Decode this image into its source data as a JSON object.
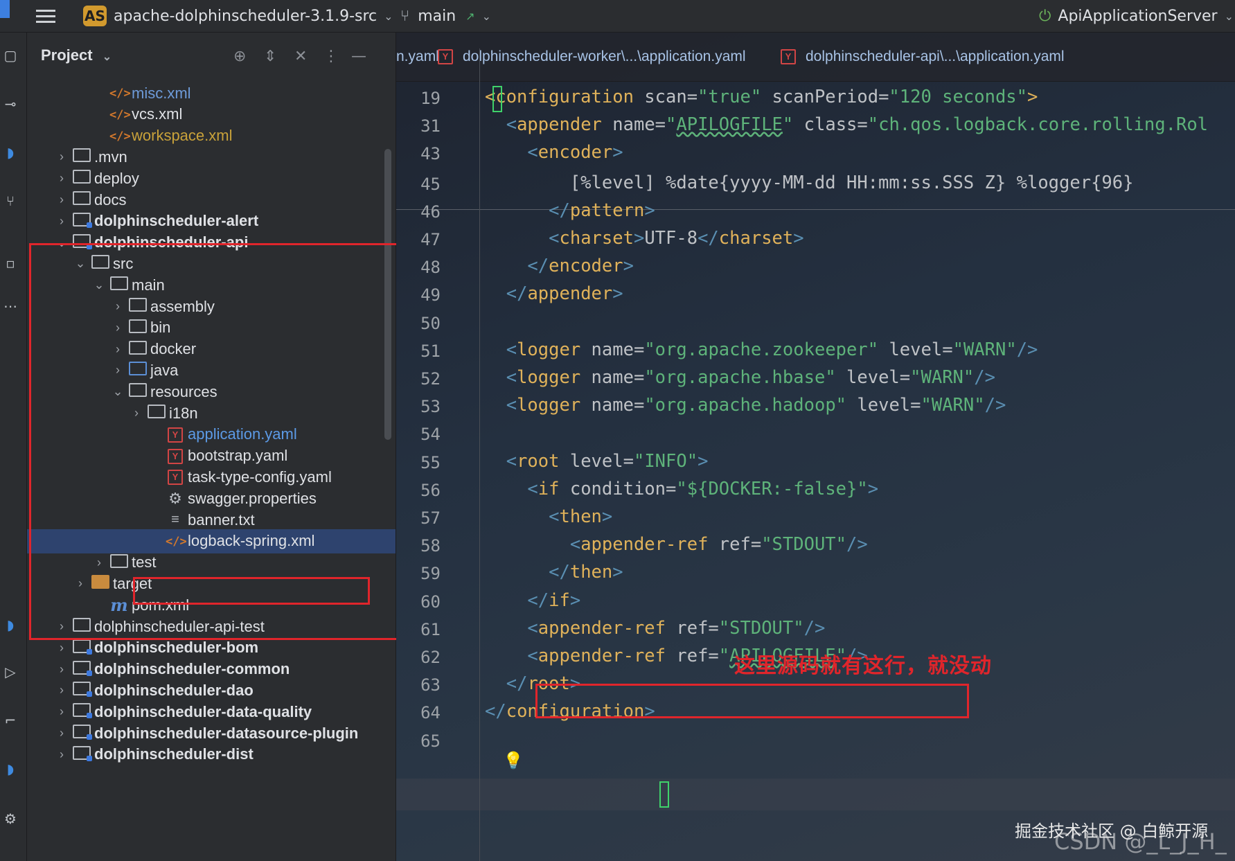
{
  "titlebar": {
    "project_badge": "AS",
    "project_name": "apache-dolphinscheduler-3.1.9-src",
    "branch": "main",
    "run_config": "ApiApplicationServer"
  },
  "panel": {
    "title": "Project"
  },
  "tree": [
    {
      "label": "misc.xml",
      "icon": "xml-file-icon",
      "style": "lbl-blue2"
    },
    {
      "label": "vcs.xml",
      "icon": "xml-file-icon",
      "style": "lbl-normal"
    },
    {
      "label": "workspace.xml",
      "icon": "xml-file-icon",
      "style": "lbl-orange"
    },
    {
      "label": ".mvn",
      "icon": "folder-icon",
      "style": "lbl-normal",
      "arrow": "›"
    },
    {
      "label": "deploy",
      "icon": "folder-icon",
      "style": "lbl-normal",
      "arrow": "›"
    },
    {
      "label": "docs",
      "icon": "folder-icon",
      "style": "lbl-normal",
      "arrow": "›"
    },
    {
      "label": "dolphinscheduler-alert",
      "icon": "module-folder-icon",
      "style": "lbl-bold",
      "arrow": "›"
    },
    {
      "label": "dolphinscheduler-api",
      "icon": "module-folder-icon",
      "style": "lbl-bold",
      "arrow": "⌄"
    },
    {
      "label": "src",
      "icon": "folder-icon",
      "style": "lbl-normal",
      "arrow": "⌄"
    },
    {
      "label": "main",
      "icon": "folder-icon",
      "style": "lbl-normal",
      "arrow": "⌄"
    },
    {
      "label": "assembly",
      "icon": "folder-icon",
      "style": "lbl-normal",
      "arrow": "›"
    },
    {
      "label": "bin",
      "icon": "folder-icon",
      "style": "lbl-normal",
      "arrow": "›"
    },
    {
      "label": "docker",
      "icon": "folder-icon",
      "style": "lbl-normal",
      "arrow": "›"
    },
    {
      "label": "java",
      "icon": "source-folder-icon",
      "style": "lbl-normal",
      "arrow": "›"
    },
    {
      "label": "resources",
      "icon": "resources-folder-icon",
      "style": "lbl-normal",
      "arrow": "⌄"
    },
    {
      "label": "i18n",
      "icon": "folder-icon",
      "style": "lbl-normal",
      "arrow": "›"
    },
    {
      "label": "application.yaml",
      "icon": "yaml-file-icon",
      "style": "lbl-blue"
    },
    {
      "label": "bootstrap.yaml",
      "icon": "yaml-file-icon",
      "style": "lbl-normal"
    },
    {
      "label": "task-type-config.yaml",
      "icon": "yaml-file-icon",
      "style": "lbl-normal"
    },
    {
      "label": "swagger.properties",
      "icon": "gear-icon",
      "style": "lbl-normal"
    },
    {
      "label": "banner.txt",
      "icon": "text-file-icon",
      "style": "lbl-normal"
    },
    {
      "label": "logback-spring.xml",
      "icon": "xml-file-icon",
      "style": "lbl-normal",
      "selected": true
    },
    {
      "label": "test",
      "icon": "folder-icon",
      "style": "lbl-normal",
      "arrow": "›"
    },
    {
      "label": "target",
      "icon": "excluded-folder-icon",
      "style": "lbl-normal",
      "arrow": "›"
    },
    {
      "label": "pom.xml",
      "icon": "maven-icon",
      "style": "lbl-normal"
    },
    {
      "label": "dolphinscheduler-api-test",
      "icon": "folder-icon",
      "style": "lbl-normal",
      "arrow": "›"
    },
    {
      "label": "dolphinscheduler-bom",
      "icon": "module-folder-icon",
      "style": "lbl-bold",
      "arrow": "›"
    },
    {
      "label": "dolphinscheduler-common",
      "icon": "module-folder-icon",
      "style": "lbl-bold",
      "arrow": "›"
    },
    {
      "label": "dolphinscheduler-dao",
      "icon": "module-folder-icon",
      "style": "lbl-bold",
      "arrow": "›"
    },
    {
      "label": "dolphinscheduler-data-quality",
      "icon": "module-folder-icon",
      "style": "lbl-bold",
      "arrow": "›"
    },
    {
      "label": "dolphinscheduler-datasource-plugin",
      "icon": "module-folder-icon",
      "style": "lbl-bold",
      "arrow": "›"
    },
    {
      "label": "dolphinscheduler-dist",
      "icon": "module-folder-icon",
      "style": "lbl-bold",
      "arrow": "›"
    }
  ],
  "tabs": [
    {
      "label": "n.yaml"
    },
    {
      "label": "dolphinscheduler-worker\\...\\application.yaml"
    },
    {
      "label": "dolphinscheduler-api\\...\\application.yaml"
    }
  ],
  "code_lines": [
    {
      "no": "19",
      "segs": [
        [
          "t",
          "<configuration"
        ],
        [
          "an",
          " scan="
        ],
        [
          "av",
          "\"true\""
        ],
        [
          "an",
          " scanPeriod="
        ],
        [
          "av",
          "\"120 seconds\""
        ],
        [
          "t",
          ">"
        ]
      ]
    },
    {
      "no": "31",
      "segs": [
        [
          "an",
          "  "
        ],
        [
          "ab",
          "<"
        ],
        [
          "t",
          "appender"
        ],
        [
          "an",
          " name="
        ],
        [
          "av",
          "\""
        ],
        [
          "ul",
          "APILOGFILE"
        ],
        [
          "av",
          "\""
        ],
        [
          "an",
          " class="
        ],
        [
          "av",
          "\"ch.qos.logback.core.rolling.Rol"
        ]
      ]
    },
    {
      "no": "43",
      "segs": [
        [
          "an",
          "    "
        ],
        [
          "ab",
          "<"
        ],
        [
          "t",
          "encoder"
        ],
        [
          "ab",
          ">"
        ]
      ]
    },
    {
      "no": "45",
      "segs": [
        [
          "an",
          "        [%level] %date{yyyy-MM-dd HH:mm:ss.SSS Z} %logger{96}"
        ]
      ]
    },
    {
      "no": "46",
      "segs": [
        [
          "an",
          "      "
        ],
        [
          "ab",
          "</"
        ],
        [
          "t",
          "pattern"
        ],
        [
          "ab",
          ">"
        ]
      ]
    },
    {
      "no": "47",
      "segs": [
        [
          "an",
          "      "
        ],
        [
          "ab",
          "<"
        ],
        [
          "t",
          "charset"
        ],
        [
          "ab",
          ">"
        ],
        [
          "an",
          "UTF-8"
        ],
        [
          "ab",
          "</"
        ],
        [
          "t",
          "charset"
        ],
        [
          "ab",
          ">"
        ]
      ]
    },
    {
      "no": "48",
      "segs": [
        [
          "an",
          "    "
        ],
        [
          "ab",
          "</"
        ],
        [
          "t",
          "encoder"
        ],
        [
          "ab",
          ">"
        ]
      ]
    },
    {
      "no": "49",
      "segs": [
        [
          "an",
          "  "
        ],
        [
          "ab",
          "</"
        ],
        [
          "t",
          "appender"
        ],
        [
          "ab",
          ">"
        ]
      ]
    },
    {
      "no": "50",
      "segs": []
    },
    {
      "no": "51",
      "segs": [
        [
          "an",
          "  "
        ],
        [
          "ab",
          "<"
        ],
        [
          "t",
          "logger"
        ],
        [
          "an",
          " name="
        ],
        [
          "av",
          "\"org.apache.zookeeper\""
        ],
        [
          "an",
          " level="
        ],
        [
          "av",
          "\"WARN\""
        ],
        [
          "ab",
          "/>"
        ]
      ]
    },
    {
      "no": "52",
      "segs": [
        [
          "an",
          "  "
        ],
        [
          "ab",
          "<"
        ],
        [
          "t",
          "logger"
        ],
        [
          "an",
          " name="
        ],
        [
          "av",
          "\"org.apache.hbase\""
        ],
        [
          "an",
          " level="
        ],
        [
          "av",
          "\"WARN\""
        ],
        [
          "ab",
          "/>"
        ]
      ]
    },
    {
      "no": "53",
      "segs": [
        [
          "an",
          "  "
        ],
        [
          "ab",
          "<"
        ],
        [
          "t",
          "logger"
        ],
        [
          "an",
          " name="
        ],
        [
          "av",
          "\"org.apache.hadoop\""
        ],
        [
          "an",
          " level="
        ],
        [
          "av",
          "\"WARN\""
        ],
        [
          "ab",
          "/>"
        ]
      ]
    },
    {
      "no": "54",
      "segs": []
    },
    {
      "no": "55",
      "segs": [
        [
          "an",
          "  "
        ],
        [
          "ab",
          "<"
        ],
        [
          "t",
          "root"
        ],
        [
          "an",
          " level="
        ],
        [
          "av",
          "\"INFO\""
        ],
        [
          "ab",
          ">"
        ]
      ]
    },
    {
      "no": "56",
      "segs": [
        [
          "an",
          "    "
        ],
        [
          "ab",
          "<"
        ],
        [
          "t",
          "if"
        ],
        [
          "an",
          " condition="
        ],
        [
          "av",
          "\"${DOCKER:-false}\""
        ],
        [
          "ab",
          ">"
        ]
      ]
    },
    {
      "no": "57",
      "segs": [
        [
          "an",
          "      "
        ],
        [
          "ab",
          "<"
        ],
        [
          "t",
          "then"
        ],
        [
          "ab",
          ">"
        ]
      ]
    },
    {
      "no": "58",
      "segs": [
        [
          "an",
          "        "
        ],
        [
          "ab",
          "<"
        ],
        [
          "t",
          "appender-ref"
        ],
        [
          "an",
          " ref="
        ],
        [
          "av",
          "\"STDOUT\""
        ],
        [
          "ab",
          "/>"
        ]
      ]
    },
    {
      "no": "59",
      "segs": [
        [
          "an",
          "      "
        ],
        [
          "ab",
          "</"
        ],
        [
          "t",
          "then"
        ],
        [
          "ab",
          ">"
        ]
      ]
    },
    {
      "no": "60",
      "segs": [
        [
          "an",
          "    "
        ],
        [
          "ab",
          "</"
        ],
        [
          "t",
          "if"
        ],
        [
          "ab",
          ">"
        ]
      ]
    },
    {
      "no": "61",
      "segs": [
        [
          "an",
          "    "
        ],
        [
          "ab",
          "<"
        ],
        [
          "t",
          "appender-ref"
        ],
        [
          "an",
          " ref="
        ],
        [
          "av",
          "\"STDOUT\""
        ],
        [
          "ab",
          "/>"
        ]
      ]
    },
    {
      "no": "62",
      "segs": [
        [
          "an",
          "    "
        ],
        [
          "ab",
          "<"
        ],
        [
          "t",
          "appender-ref"
        ],
        [
          "an",
          " ref="
        ],
        [
          "av",
          "\""
        ],
        [
          "ul",
          "APILOGFILE"
        ],
        [
          "av",
          "\""
        ],
        [
          "ab",
          "/>"
        ]
      ]
    },
    {
      "no": "63",
      "segs": [
        [
          "an",
          "  "
        ],
        [
          "ab",
          "</"
        ],
        [
          "t",
          "root"
        ],
        [
          "ab",
          ">"
        ]
      ]
    },
    {
      "no": "64",
      "segs": [
        [
          "ab",
          "</"
        ],
        [
          "t",
          "configuration"
        ],
        [
          "ab",
          ">"
        ]
      ]
    },
    {
      "no": "65",
      "segs": []
    }
  ],
  "annotation": "这里源码就有这行，就没动",
  "watermark": {
    "site": "掘金技术社区 @ 白鲸开源",
    "author": "CSDN @_L_J_H_"
  },
  "colors": {
    "highlight_red": "#e0252b",
    "selection": "#2e436e",
    "tag": "#e0b25a",
    "attr_value": "#5eb37a"
  }
}
